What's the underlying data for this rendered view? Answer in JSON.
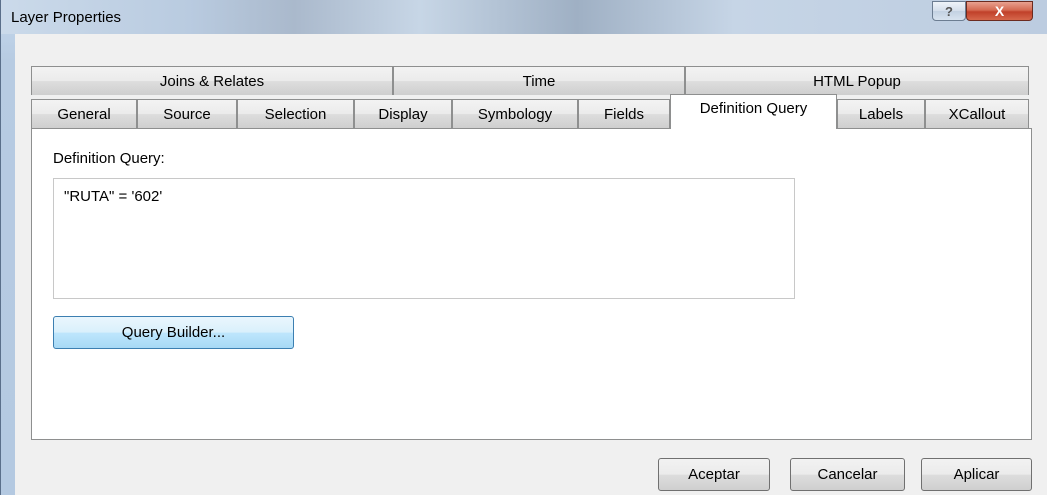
{
  "window": {
    "title": "Layer Properties",
    "help_symbol": "?",
    "close_symbol": "X"
  },
  "tabs": {
    "row1": [
      "Joins & Relates",
      "Time",
      "HTML Popup"
    ],
    "row2": [
      "General",
      "Source",
      "Selection",
      "Display",
      "Symbology",
      "Fields",
      "Definition Query",
      "Labels",
      "XCallout"
    ],
    "active": "Definition Query"
  },
  "panel": {
    "definition_query_label": "Definition Query:",
    "query_text": "\"RUTA\" = '602'",
    "query_builder_label": "Query Builder..."
  },
  "footer": {
    "ok_label": "Aceptar",
    "cancel_label": "Cancelar",
    "apply_label": "Aplicar"
  }
}
